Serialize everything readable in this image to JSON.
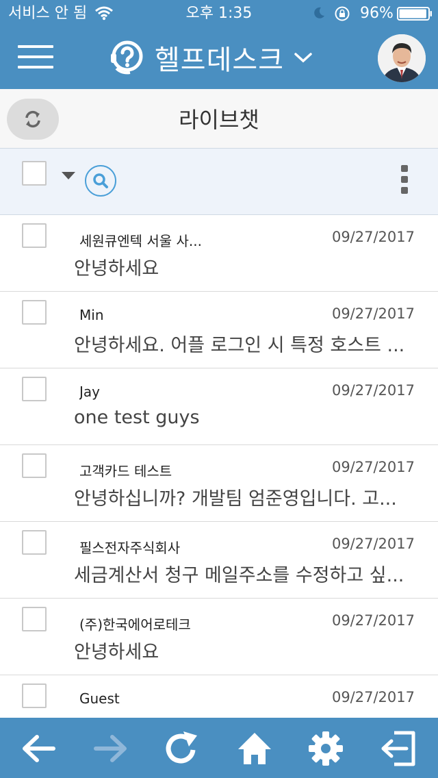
{
  "status": {
    "carrier": "서비스 안 됨",
    "time": "오후 1:35",
    "battery": "96%",
    "battery_level": 0.96
  },
  "header": {
    "title": "헬프데스크",
    "brand_icon": "help-headset-icon",
    "accent": "#4a8fc1"
  },
  "page": {
    "title": "라이브챗"
  },
  "conversations": [
    {
      "name": "세원큐엔텍 서울 사...",
      "date": "09/27/2017",
      "message": "안녕하세요"
    },
    {
      "name": "Min",
      "date": "09/27/2017",
      "message": "안녕하세요. 어플 로그인 시 특정 호스트 ..."
    },
    {
      "name": "Jay",
      "date": "09/27/2017",
      "message": "one test guys"
    },
    {
      "name": "고객카드 테스트",
      "date": "09/27/2017",
      "message": "안녕하십니까? 개발팀 엄준영입니다. 고..."
    },
    {
      "name": "필스전자주식회사",
      "date": "09/27/2017",
      "message": "세금계산서 청구 메일주소를 수정하고 싶..."
    },
    {
      "name": "(주)한국에어로테크",
      "date": "09/27/2017",
      "message": "안녕하세요"
    },
    {
      "name": "Guest",
      "date": "09/27/2017",
      "message": ""
    }
  ],
  "bottom_nav": [
    "back-arrow-icon",
    "forward-arrow-icon",
    "reload-icon",
    "home-icon",
    "gear-icon",
    "logout-icon"
  ]
}
